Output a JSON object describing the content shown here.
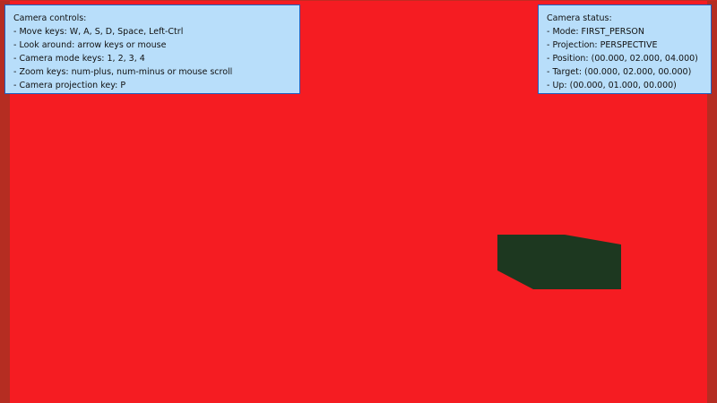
{
  "colors": {
    "background": "#f51c22",
    "left_wall": "#b52d22",
    "right_wall": "#b52d22",
    "wall_top": "#c42a22",
    "block": "#1d3820",
    "panel_fill": "#b8defa",
    "panel_border": "#1e5fbf",
    "panel_text": "#111111"
  },
  "controls_panel": {
    "title": "Camera controls:",
    "lines": [
      "- Move keys: W, A, S, D, Space, Left-Ctrl",
      "- Look around: arrow keys or mouse",
      "- Camera mode keys: 1, 2, 3, 4",
      "- Zoom keys: num-plus, num-minus or mouse scroll",
      "- Camera projection key: P"
    ]
  },
  "status_panel": {
    "title": "Camera status:",
    "lines": [
      "- Mode: FIRST_PERSON",
      "- Projection: PERSPECTIVE",
      "- Position: (00.000, 02.000, 04.000)",
      "- Target: (00.000, 02.000, 00.000)",
      "- Up: (00.000, 01.000, 00.000)"
    ]
  }
}
